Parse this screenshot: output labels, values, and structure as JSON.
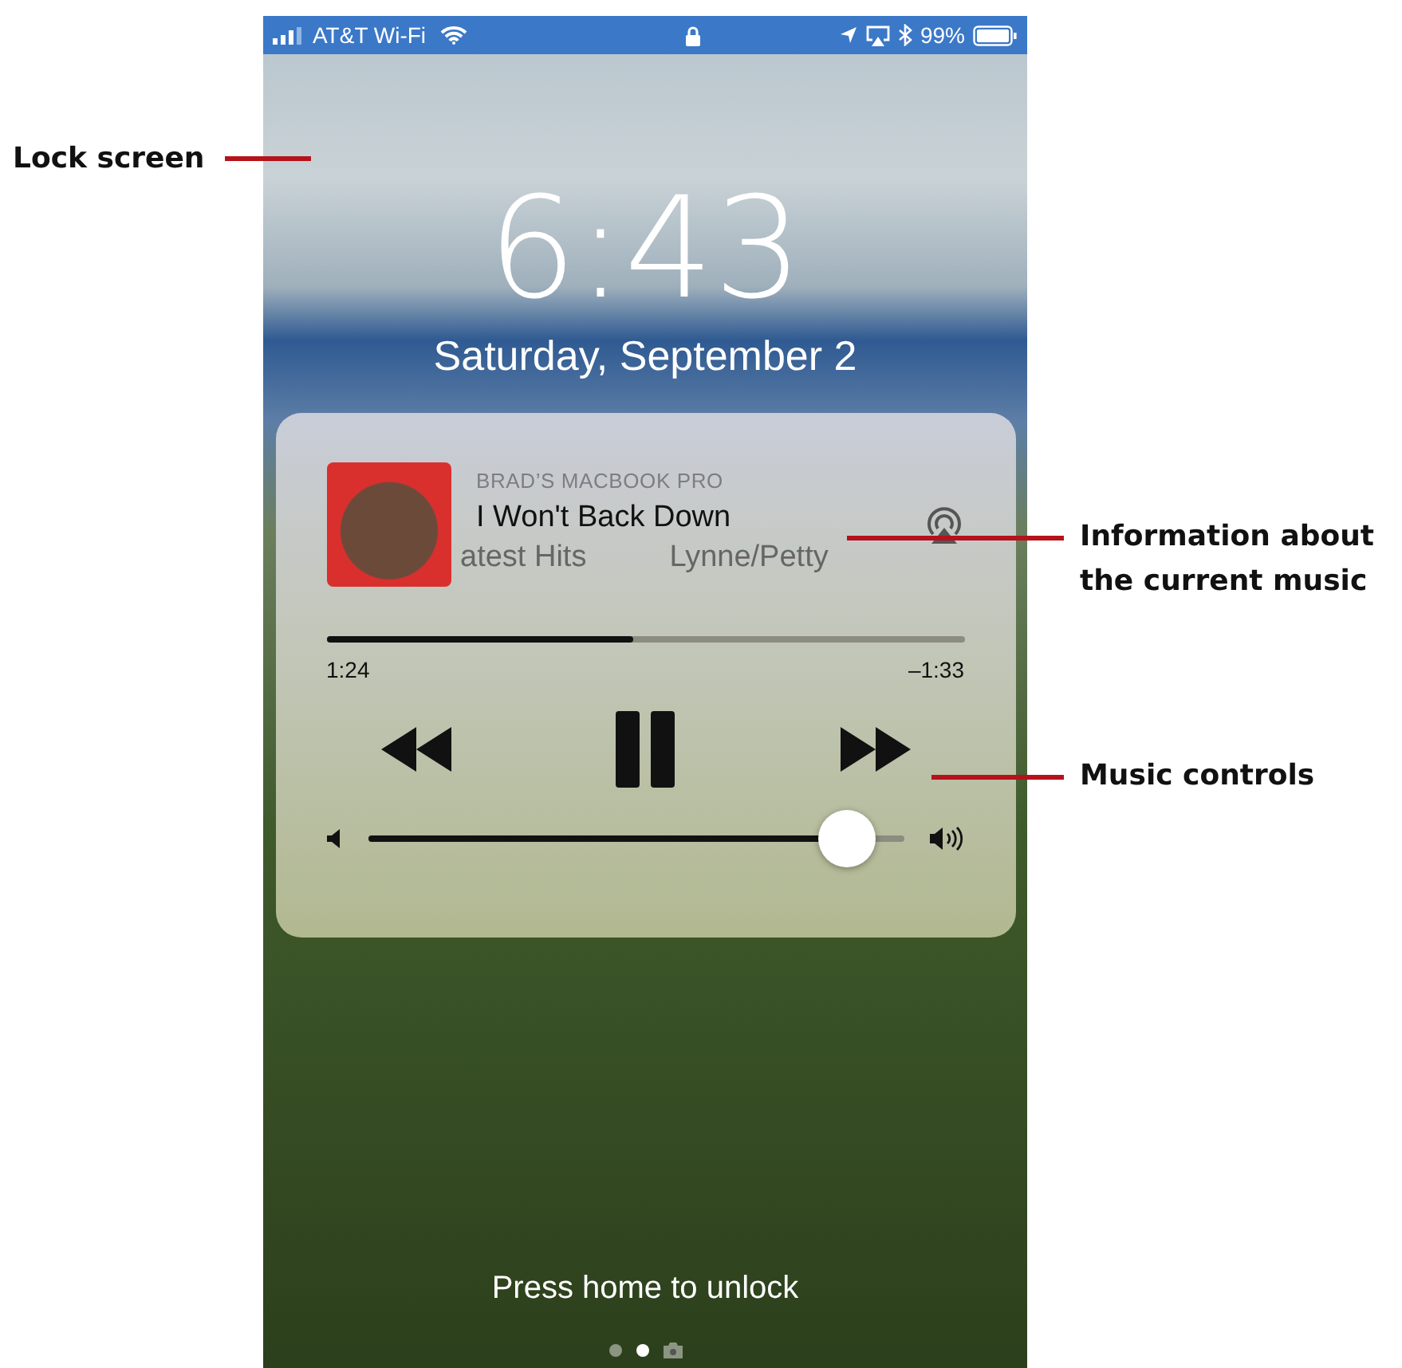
{
  "callouts_left": [
    {
      "text": "Lock screen"
    }
  ],
  "callouts_right": [
    {
      "text": "Information about the current music"
    },
    {
      "text": "Music controls"
    }
  ],
  "status_bar": {
    "carrier": "AT&T Wi-Fi",
    "battery": "99%"
  },
  "clock": {
    "time": "6:43",
    "date": "Saturday, September 2"
  },
  "now_playing": {
    "source": "BRAD’S MACBOOK PRO",
    "title": "I Won't Back Down",
    "subtitle_1": "atest Hits",
    "subtitle_2": "Lynne/Petty",
    "progress": {
      "level": 0.48
    },
    "elapsed": "1:24",
    "remaining": "–1:33",
    "playing": true,
    "volume": {
      "level": 0.94
    }
  },
  "unlock_hint": "Press home to unlock",
  "pages": [
    {
      "kind": "dot",
      "selected": false
    },
    {
      "kind": "dot",
      "selected": true
    },
    {
      "kind": "camera",
      "selected": false
    }
  ]
}
